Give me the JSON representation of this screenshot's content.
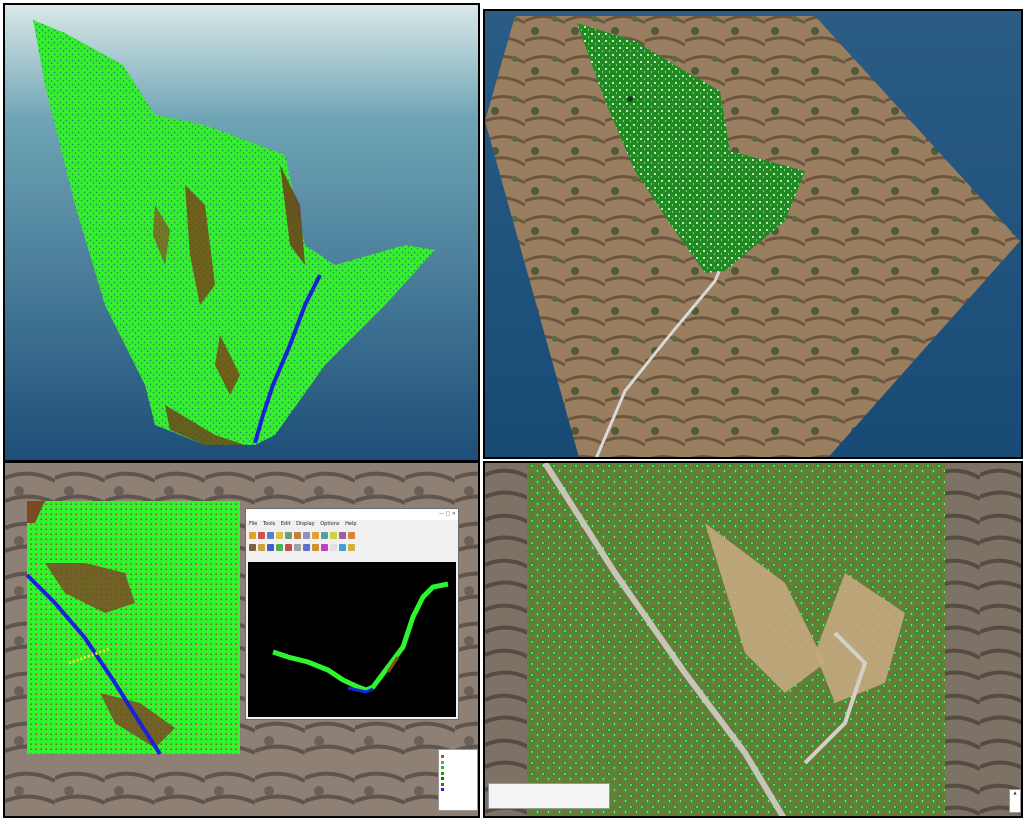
{
  "panels": [
    {
      "id": "3d-classified-point-cloud"
    },
    {
      "id": "3d-point-cloud-over-orthophoto"
    },
    {
      "id": "cross-section-profile-view"
    },
    {
      "id": "top-down-tree-detection"
    }
  ],
  "profile_window": {
    "title": "",
    "menu": [
      "File",
      "Tools",
      "Edit",
      "Display",
      "Options",
      "Help"
    ]
  },
  "legend": {
    "title": "",
    "items": [
      {
        "color": "#a65a1f"
      },
      {
        "color": "#8a8a8a"
      },
      {
        "color": "#22c022"
      },
      {
        "color": "#11a011"
      },
      {
        "color": "#007a00"
      },
      {
        "color": "#8a4a2a"
      },
      {
        "color": "#2222dd"
      }
    ]
  },
  "scalebar": {
    "ticks": [
      "",
      "",
      "",
      "",
      ""
    ]
  },
  "colors": {
    "ground": "#8b4a22",
    "vegetation": "#2ef52e",
    "dark_vegetation": "#0f7a0f",
    "water": "#1a22d8",
    "sky_top": "#dbe9ea",
    "sky_bottom": "#1b4f78"
  }
}
